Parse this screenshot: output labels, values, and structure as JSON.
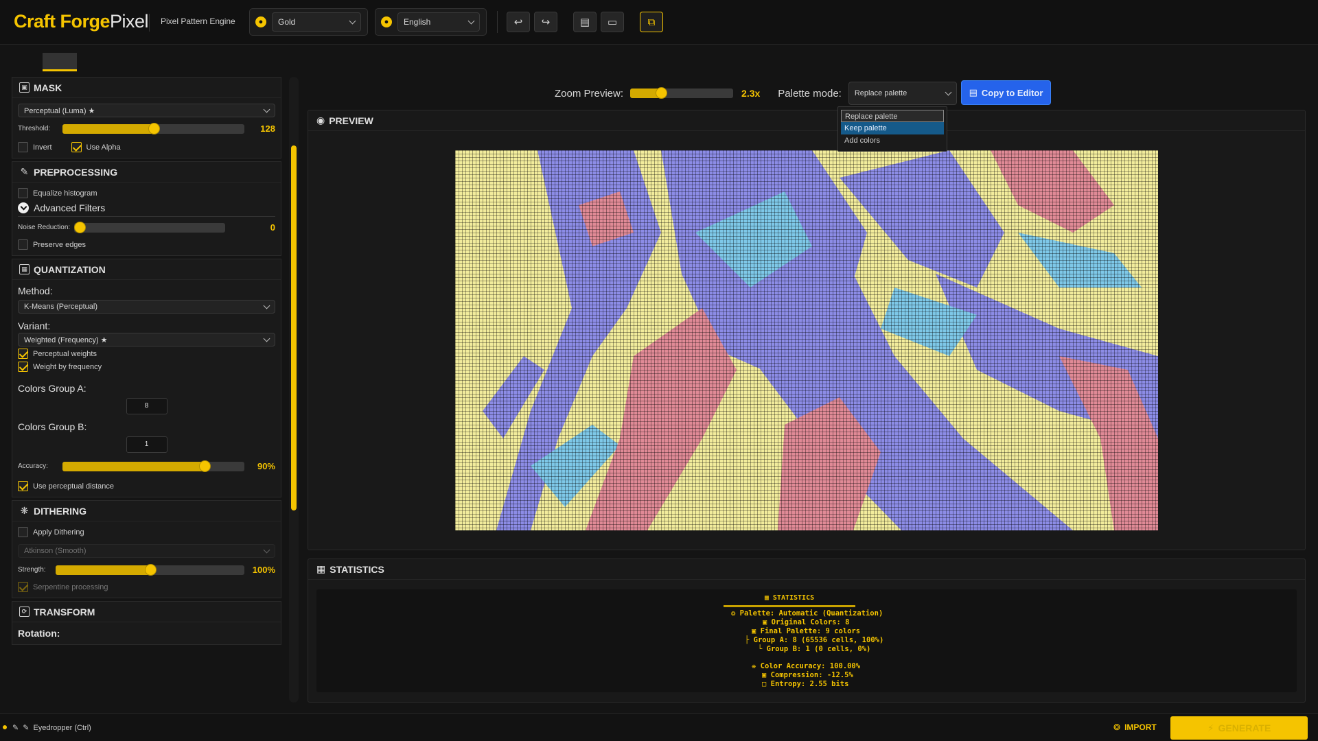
{
  "app": {
    "brand_bold": "Craft Forge",
    "brand_light": "Pixel",
    "tagline": "Pixel Pattern Engine",
    "theme_value": "Gold",
    "language_value": "English"
  },
  "toolbar": {
    "undo_icon": "undo-icon",
    "redo_icon": "redo-icon",
    "save_icon": "save-icon",
    "open_icon": "folder-icon",
    "view_icon": "window-icon"
  },
  "sidebar": {
    "mask": {
      "title": "MASK",
      "mode": "Perceptual (Luma) ★",
      "threshold_label": "Threshold:",
      "threshold_value": "128",
      "threshold_level": 0.5,
      "invert_label": "Invert",
      "invert_checked": false,
      "use_alpha_label": "Use Alpha",
      "use_alpha_checked": true
    },
    "preprocessing": {
      "title": "PREPROCESSING",
      "equalize_label": "Equalize histogram",
      "equalize_checked": false,
      "advanced_label": "Advanced Filters",
      "noise_label": "Noise Reduction:",
      "noise_value": "0",
      "noise_level": 0,
      "preserve_label": "Preserve edges",
      "preserve_checked": false
    },
    "quantization": {
      "title": "QUANTIZATION",
      "method_label": "Method:",
      "method_value": "K-Means (Perceptual)",
      "variant_label": "Variant:",
      "variant_value": "Weighted (Frequency) ★",
      "perceptual_weights_label": "Perceptual weights",
      "weight_frequency_label": "Weight by frequency",
      "group_a_label": "Colors Group A:",
      "group_a_value": "8",
      "group_b_label": "Colors Group B:",
      "group_b_value": "1",
      "accuracy_label": "Accuracy:",
      "accuracy_value": "90%",
      "accuracy_level": 0.78,
      "perceptual_distance_label": "Use perceptual distance"
    },
    "dithering": {
      "title": "DITHERING",
      "apply_label": "Apply Dithering",
      "algorithm_value": "Atkinson (Smooth)",
      "strength_label": "Strength:",
      "strength_value": "100%",
      "strength_level": 0.5,
      "serpentine_label": "Serpentine processing"
    },
    "transform": {
      "title": "TRANSFORM",
      "rotation_label": "Rotation:"
    }
  },
  "preview": {
    "zoom_label": "Zoom Preview:",
    "zoom_value": "2.3x",
    "zoom_level": 0.3,
    "palette_mode_label": "Palette mode:",
    "palette_mode_value": "Replace palette",
    "palette_options": [
      "Replace palette",
      "Keep palette",
      "Add colors"
    ],
    "copy_button": "Copy to Editor",
    "panel_title": "PREVIEW"
  },
  "statistics": {
    "panel_title": "STATISTICS",
    "box_title": "STATISTICS",
    "lines": [
      "Palette: Automatic (Quantization)",
      "Original Colors: 8",
      "Final Palette: 9 colors",
      "├ Group A: 8 (65536 cells, 100%)",
      "└ Group B: 1 (0 cells, 0%)",
      "Color Accuracy: 100.00%",
      "Compression: -12.5%",
      "Entropy: 2.55 bits"
    ]
  },
  "footer": {
    "eyedropper": "Eyedropper (Ctrl)",
    "import_label": "IMPORT",
    "generate_label": "GENERATE"
  },
  "colors": {
    "accent": "#f5c400",
    "primary_button": "#2563eb",
    "pattern_yellow": "#f2ec9c",
    "pattern_purple": "#8c8ce6",
    "pattern_cyan": "#7ec8e8",
    "pattern_pink": "#e08a96"
  }
}
